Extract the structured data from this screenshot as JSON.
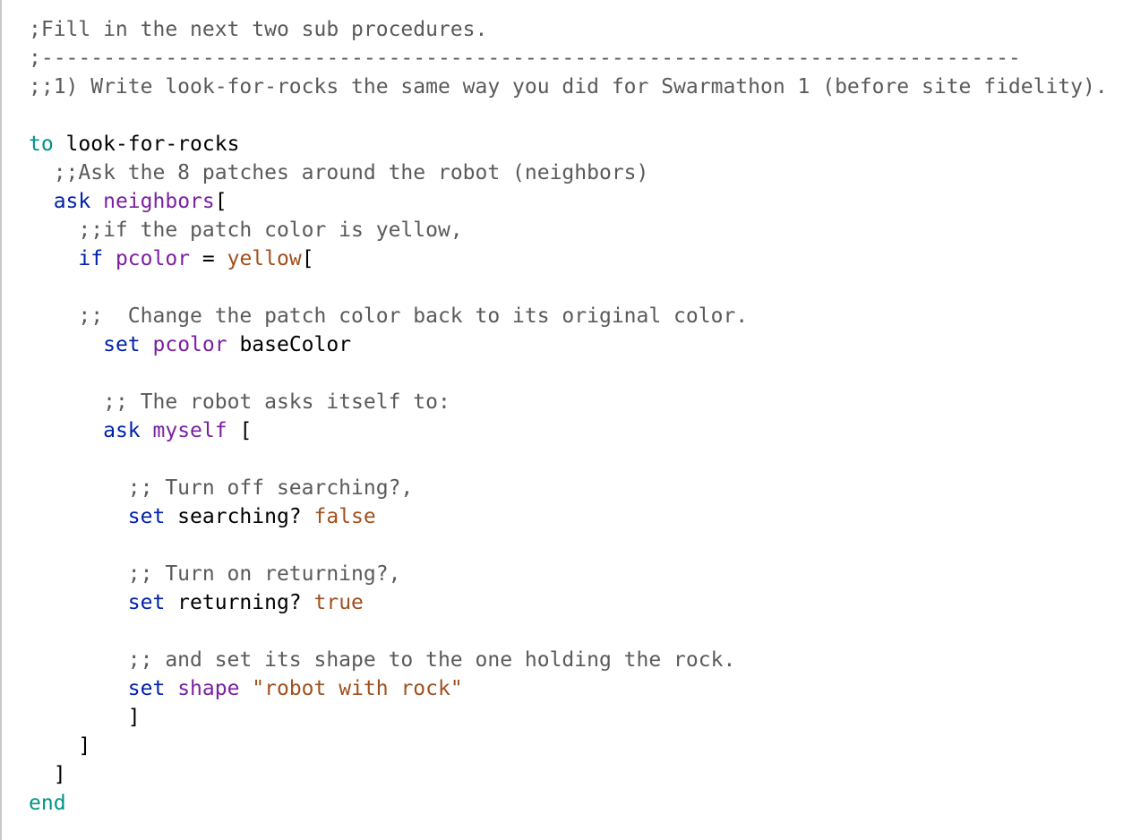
{
  "colors": {
    "background": "#ffffff",
    "gutter_border": "#c9c9c9",
    "comment": "#5a5a5a",
    "keyword": "#009485",
    "command": "#0022aa",
    "reporter": "#7a1fa2",
    "constant": "#a0501e",
    "plain": "#000000"
  },
  "lines": [
    [
      {
        "t": ";Fill in the next two sub procedures.",
        "c": "comment"
      }
    ],
    [
      {
        "t": ";-------------------------------------------------------------------------------",
        "c": "comment"
      }
    ],
    [
      {
        "t": ";;1) Write look-for-rocks the same way you did for Swarmathon 1 (before site fidelity).",
        "c": "comment"
      }
    ],
    [],
    [
      {
        "t": "to",
        "c": "keyword"
      },
      {
        "t": " look-for-rocks",
        "c": "plain"
      }
    ],
    [
      {
        "t": "  ",
        "c": "plain"
      },
      {
        "t": ";;Ask the 8 patches around the robot (neighbors)",
        "c": "comment"
      }
    ],
    [
      {
        "t": "  ",
        "c": "plain"
      },
      {
        "t": "ask",
        "c": "command"
      },
      {
        "t": " ",
        "c": "plain"
      },
      {
        "t": "neighbors",
        "c": "reporter"
      },
      {
        "t": "[",
        "c": "plain"
      }
    ],
    [
      {
        "t": "    ",
        "c": "plain"
      },
      {
        "t": ";;if the patch color is yellow,",
        "c": "comment"
      }
    ],
    [
      {
        "t": "    ",
        "c": "plain"
      },
      {
        "t": "if",
        "c": "command"
      },
      {
        "t": " ",
        "c": "plain"
      },
      {
        "t": "pcolor",
        "c": "reporter"
      },
      {
        "t": " = ",
        "c": "plain"
      },
      {
        "t": "yellow",
        "c": "constant"
      },
      {
        "t": "[",
        "c": "plain"
      }
    ],
    [],
    [
      {
        "t": "    ",
        "c": "plain"
      },
      {
        "t": ";;  Change the patch color back to its original color.",
        "c": "comment"
      }
    ],
    [
      {
        "t": "      ",
        "c": "plain"
      },
      {
        "t": "set",
        "c": "command"
      },
      {
        "t": " ",
        "c": "plain"
      },
      {
        "t": "pcolor",
        "c": "reporter"
      },
      {
        "t": " baseColor",
        "c": "plain"
      }
    ],
    [],
    [
      {
        "t": "      ",
        "c": "plain"
      },
      {
        "t": ";; The robot asks itself to:",
        "c": "comment"
      }
    ],
    [
      {
        "t": "      ",
        "c": "plain"
      },
      {
        "t": "ask",
        "c": "command"
      },
      {
        "t": " ",
        "c": "plain"
      },
      {
        "t": "myself",
        "c": "reporter"
      },
      {
        "t": " [",
        "c": "plain"
      }
    ],
    [],
    [
      {
        "t": "        ",
        "c": "plain"
      },
      {
        "t": ";; Turn off searching?,",
        "c": "comment"
      }
    ],
    [
      {
        "t": "        ",
        "c": "plain"
      },
      {
        "t": "set",
        "c": "command"
      },
      {
        "t": " searching? ",
        "c": "plain"
      },
      {
        "t": "false",
        "c": "constant"
      }
    ],
    [],
    [
      {
        "t": "        ",
        "c": "plain"
      },
      {
        "t": ";; Turn on returning?,",
        "c": "comment"
      }
    ],
    [
      {
        "t": "        ",
        "c": "plain"
      },
      {
        "t": "set",
        "c": "command"
      },
      {
        "t": " returning? ",
        "c": "plain"
      },
      {
        "t": "true",
        "c": "constant"
      }
    ],
    [],
    [
      {
        "t": "        ",
        "c": "plain"
      },
      {
        "t": ";; and set its shape to the one holding the rock.",
        "c": "comment"
      }
    ],
    [
      {
        "t": "        ",
        "c": "plain"
      },
      {
        "t": "set",
        "c": "command"
      },
      {
        "t": " ",
        "c": "plain"
      },
      {
        "t": "shape",
        "c": "reporter"
      },
      {
        "t": " ",
        "c": "plain"
      },
      {
        "t": "\"robot with rock\"",
        "c": "constant"
      }
    ],
    [
      {
        "t": "        ]",
        "c": "plain"
      }
    ],
    [
      {
        "t": "    ]",
        "c": "plain"
      }
    ],
    [
      {
        "t": "  ]",
        "c": "plain"
      }
    ],
    [
      {
        "t": "end",
        "c": "keyword"
      }
    ]
  ]
}
